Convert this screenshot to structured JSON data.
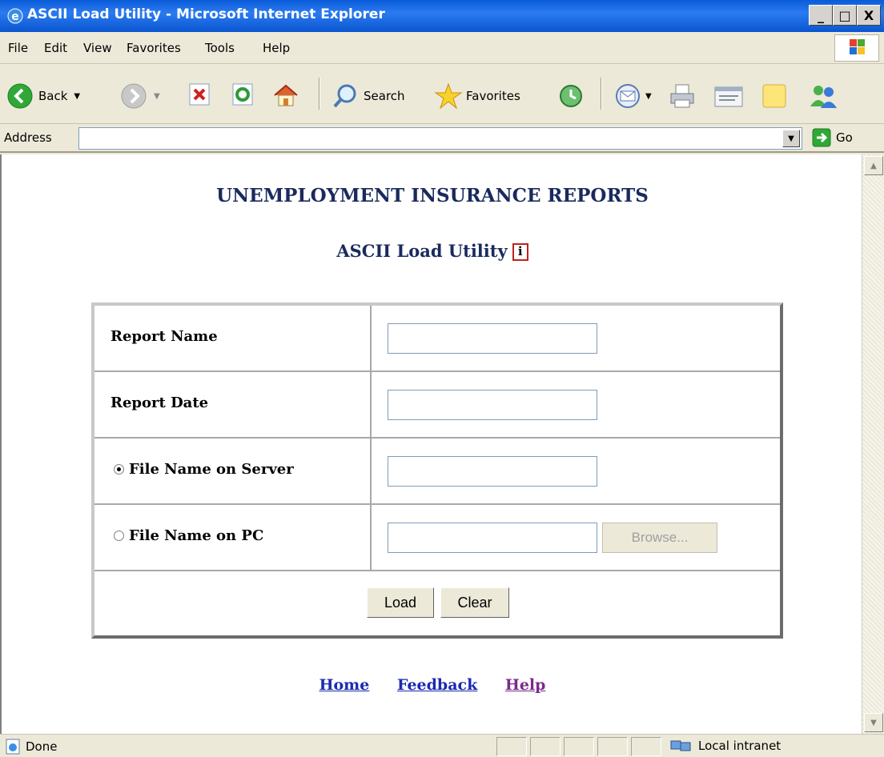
{
  "window": {
    "title": "ASCII Load Utility - Microsoft Internet Explorer",
    "controls": [
      "_",
      "□",
      "X"
    ]
  },
  "menu": {
    "items": [
      "File",
      "Edit",
      "View",
      "Favorites",
      "Tools",
      "Help"
    ]
  },
  "toolbar": {
    "back_label": "Back",
    "search_label": "Search",
    "favorites_label": "Favorites"
  },
  "address": {
    "label": "Address",
    "value": "",
    "go_label": "Go"
  },
  "page": {
    "title": "UNEMPLOYMENT INSURANCE REPORTS",
    "subtitle": "ASCII Load Utility",
    "info_glyph": "i",
    "form": {
      "report_name_label": "Report Name",
      "report_name_value": "",
      "report_date_label": "Report Date",
      "report_date_value": "",
      "server_file_label": "File Name on Server",
      "server_file_value": "",
      "server_file_selected": true,
      "pc_file_label": "File Name on PC",
      "pc_file_value": "",
      "pc_file_selected": false,
      "browse_label": "Browse...",
      "load_label": "Load",
      "clear_label": "Clear"
    },
    "links": {
      "home": "Home",
      "feedback": "Feedback",
      "help": "Help"
    }
  },
  "status": {
    "text": "Done",
    "zone": "Local intranet"
  },
  "colors": {
    "heading": "#1a2a5e",
    "link": "#1a2ab0",
    "visited_link": "#7a2a8a",
    "titlebar": "#0a5bd8"
  }
}
